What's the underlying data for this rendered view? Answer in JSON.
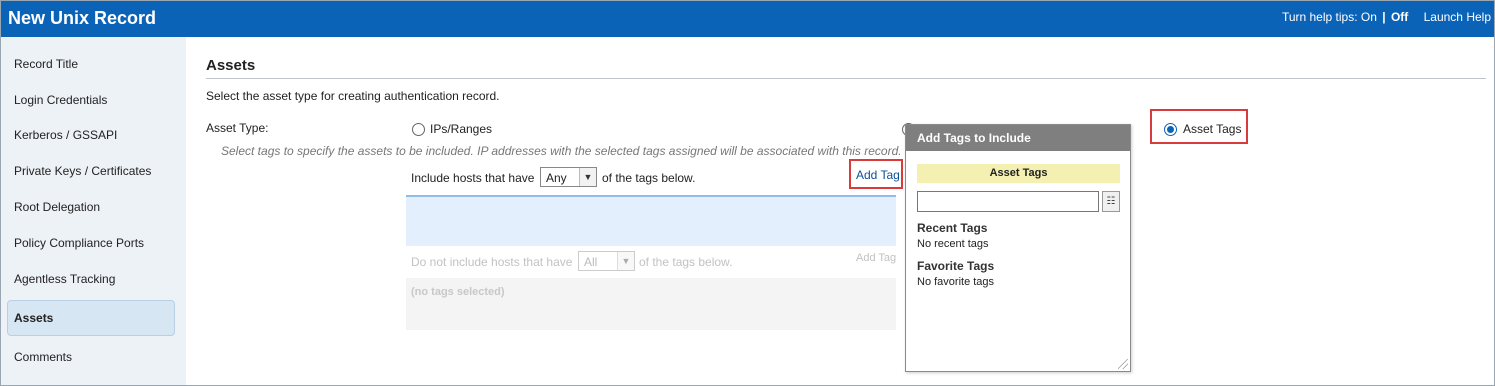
{
  "window": {
    "title": "New Unix Record",
    "help_prefix": "Turn help tips:",
    "help_on": "On",
    "help_sep": "|",
    "help_off": "Off",
    "launch_help": "Launch Help"
  },
  "sidebar": {
    "items": [
      {
        "label": "Record Title"
      },
      {
        "label": "Login Credentials"
      },
      {
        "label": "Kerberos / GSSAPI"
      },
      {
        "label": "Private Keys / Certificates"
      },
      {
        "label": "Root Delegation"
      },
      {
        "label": "Policy Compliance Ports"
      },
      {
        "label": "Agentless Tracking"
      },
      {
        "label": "Assets",
        "active": true
      },
      {
        "label": "Comments"
      }
    ]
  },
  "main": {
    "heading": "Assets",
    "description": "Select the asset type for creating authentication record.",
    "asset_type_label": "Asset Type:",
    "options": {
      "ips_ranges": "IPs/Ranges",
      "asset_tags": "Asset Tags",
      "selected": "asset_tags"
    },
    "hint": "Select tags to specify the assets to be included. IP addresses with the selected tags assigned will be associated with this record.",
    "include": {
      "text_before": "Include hosts that have",
      "select_value": "Any",
      "text_after": "of the tags below.",
      "add_tag": "Add Tag"
    },
    "exclude": {
      "text_before": "Do not include hosts that have",
      "select_value": "All",
      "text_after": "of the tags below.",
      "add_tag": "Add Tag",
      "empty": "(no tags selected)"
    }
  },
  "popup": {
    "title": "Add Tags to Include",
    "section": "Asset Tags",
    "input_value": "",
    "recent_heading": "Recent Tags",
    "recent_empty": "No recent tags",
    "favorite_heading": "Favorite Tags",
    "favorite_empty": "No favorite tags"
  },
  "colors": {
    "titlebar": "#0b63b8",
    "highlight": "#d93b3b",
    "sidebar_bg": "#edf2f7",
    "popup_header": "#7f7f7f",
    "section_yellow": "#f3f0b2"
  },
  "icons": {
    "radio": "radio-icon",
    "dropdown": "chevron-down-icon",
    "tag_list": "list-icon",
    "resize": "resize-grip-icon"
  }
}
